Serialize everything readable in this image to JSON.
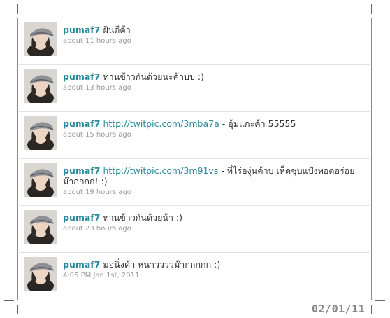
{
  "tweets": [
    {
      "user": "pumaf7",
      "link": "",
      "text": "ฝันดีค้า",
      "time": "about 11 hours ago"
    },
    {
      "user": "pumaf7",
      "link": "",
      "text": "ทานข้าวกันด้วยนะค้าบบ :)",
      "time": "about 13 hours ago"
    },
    {
      "user": "pumaf7",
      "link": "http://twitpic.com/3mba7a",
      "text": "- อุ้มแกะค้า 55555",
      "time": "about 15 hours ago"
    },
    {
      "user": "pumaf7",
      "link": "http://twitpic.com/3m91vs",
      "text": "- ที่ไร่องุ่นค้าบ เห็ดชุบแป้งทอดอร่อยม๊ากกกก! :)",
      "time": "about 19 hours ago"
    },
    {
      "user": "pumaf7",
      "link": "",
      "text": "ทานข้าวกันด้วยน้า :)",
      "time": "about 23 hours ago"
    },
    {
      "user": "pumaf7",
      "link": "",
      "text": "มอนิ่งค้า หนาววววม๊ากกกกก ;)",
      "time": "4:05 PM Jan 1st, 2011"
    }
  ],
  "date_stamp": "02/01/11",
  "colors": {
    "username": "#2a8a99",
    "timestamp": "#999999",
    "text": "#333333"
  }
}
